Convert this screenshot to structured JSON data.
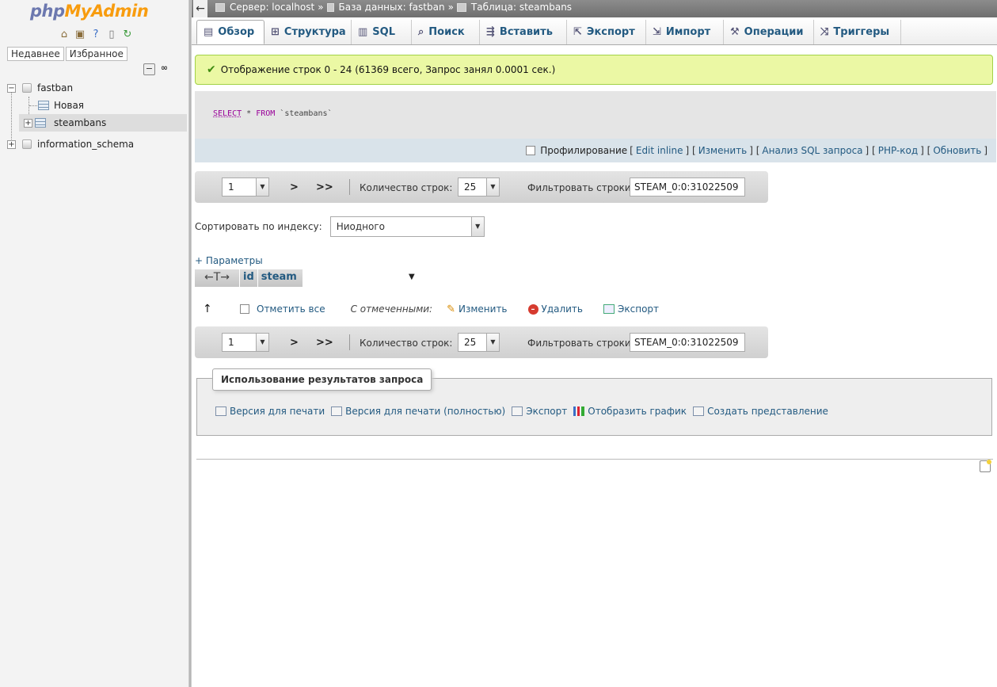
{
  "app": {
    "logo_php": "php",
    "logo_myadmin": "MyAdmin"
  },
  "nav": {
    "home_icon": "home-icon",
    "logout_icon": "logout-icon",
    "help_icon": "help-icon",
    "docs_icon": "docs-icon",
    "reload_icon": "reload-icon",
    "recent_label": "Недавнее",
    "favorites_label": "Избранное",
    "collapse_label": "−",
    "link_label": "∞",
    "tree": {
      "db1": "fastban",
      "new_table": "Новая",
      "table1": "steambans",
      "db2": "information_schema"
    }
  },
  "topbar": {
    "back_label": "←",
    "server": "Сервер: localhost",
    "database": "База данных: fastban",
    "table": "Таблица: steambans",
    "separator": "»"
  },
  "tabs": [
    {
      "label": "Обзор",
      "icon": "browse-icon",
      "glyph": "▤"
    },
    {
      "label": "Структура",
      "icon": "structure-icon",
      "glyph": "⊞"
    },
    {
      "label": "SQL",
      "icon": "sql-icon",
      "glyph": "▥"
    },
    {
      "label": "Поиск",
      "icon": "search-icon",
      "glyph": "⌕"
    },
    {
      "label": "Вставить",
      "icon": "insert-icon",
      "glyph": "⇶"
    },
    {
      "label": "Экспорт",
      "icon": "export-icon",
      "glyph": "⇱"
    },
    {
      "label": "Импорт",
      "icon": "import-icon",
      "glyph": "⇲"
    },
    {
      "label": "Операции",
      "icon": "operations-icon",
      "glyph": "⚒"
    },
    {
      "label": "Триггеры",
      "icon": "triggers-icon",
      "glyph": "⤨"
    }
  ],
  "success": {
    "message": "Отображение строк 0 - 24 (61369 всего, Запрос занял 0.0001 сек.)"
  },
  "sql": {
    "kw_select": "SELECT",
    "star": " * ",
    "kw_from": "FROM",
    "table": " `steambans`"
  },
  "sql_tools": {
    "profiling": "Профилирование",
    "edit_inline": "Edit inline",
    "edit": "Изменить",
    "analyze": "Анализ SQL запроса",
    "php_code": "PHP-код",
    "refresh": "Обновить"
  },
  "pager": {
    "page": "1",
    "next": ">",
    "last": ">>",
    "rows_label": "Количество строк:",
    "rows_value": "25",
    "filter_label": "Фильтровать строки:",
    "filter_value": "STEAM_0:0:31022509"
  },
  "sort": {
    "label": "Сортировать по индексу:",
    "value": "Ниодного"
  },
  "params_label": "+ Параметры",
  "columns": {
    "arrows": "←T→",
    "id": "id",
    "steam": "steam",
    "menu_glyph": "▼"
  },
  "bulk": {
    "up_arrow": "↑",
    "check_all": "Отметить все",
    "with_selected": "С отмеченными:",
    "edit": "Изменить",
    "delete": "Удалить",
    "export": "Экспорт",
    "delete_glyph": "–"
  },
  "query_results": {
    "legend": "Использование результатов запроса",
    "print": "Версия для печати",
    "print_full": "Версия для печати (полностью)",
    "export": "Экспорт",
    "chart": "Отобразить график",
    "create_view": "Создать представление"
  }
}
